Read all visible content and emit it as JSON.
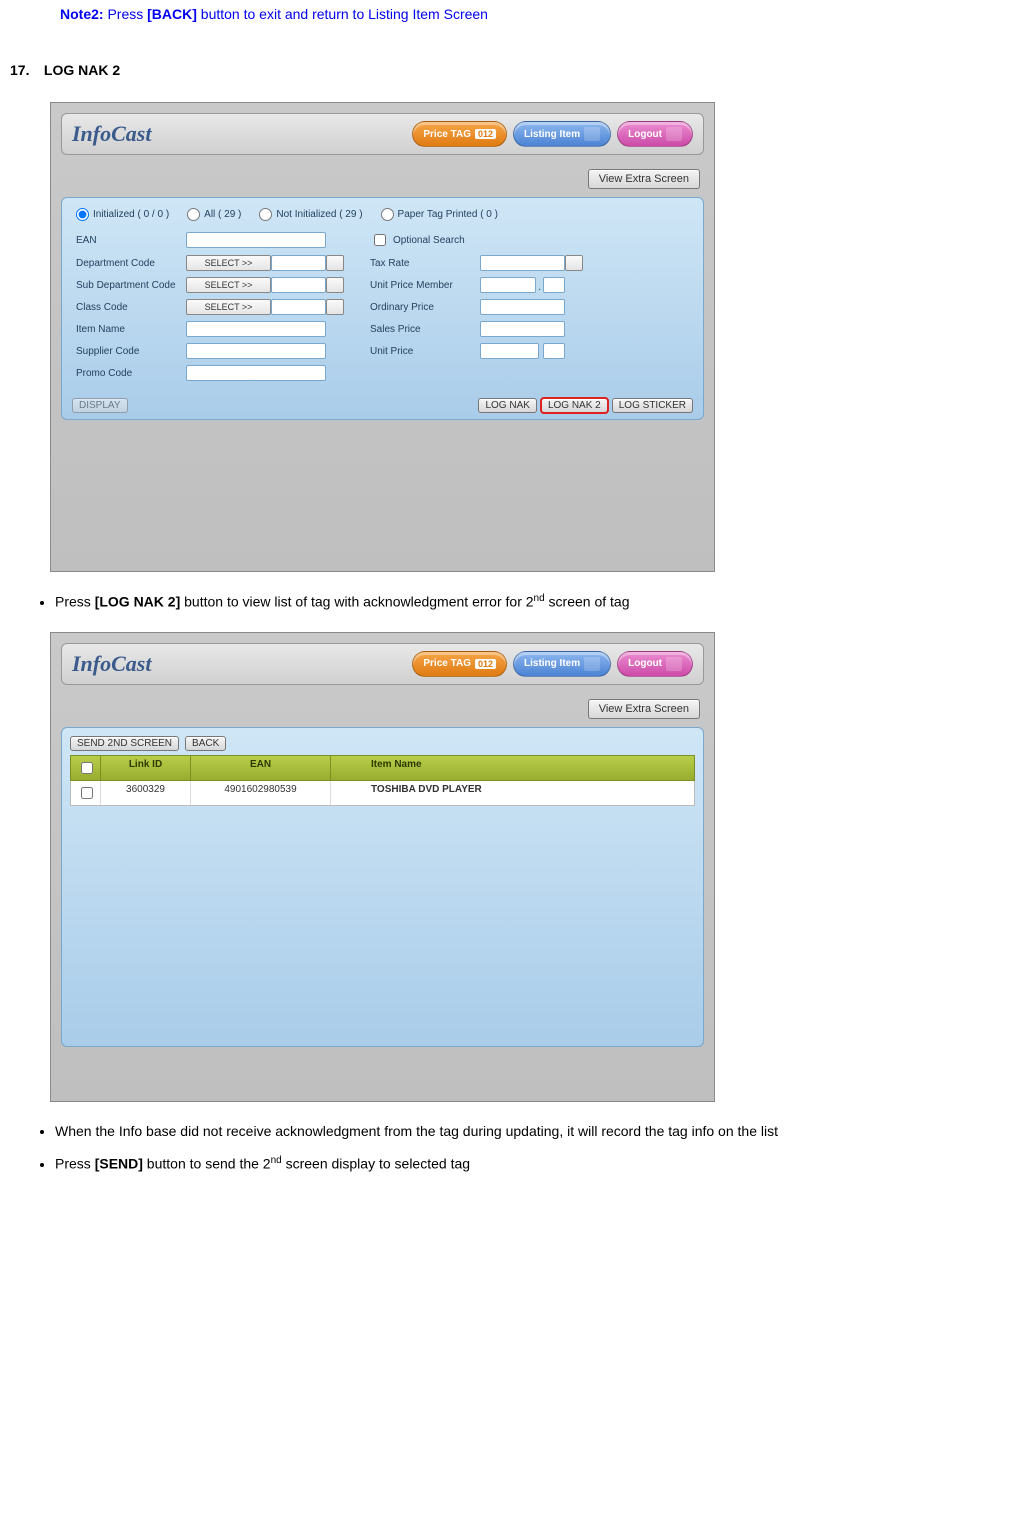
{
  "note": {
    "label": "Note2:",
    "text_before": " Press ",
    "back": "[BACK]",
    "text_after": " button to exit and return to Listing Item Screen"
  },
  "section": {
    "num": "17.",
    "title": "LOG NAK 2"
  },
  "logo": "InfoCast",
  "topButtons": {
    "priceTag": "Price TAG",
    "priceTagCode": "012",
    "listing": "Listing Item",
    "logout": "Logout"
  },
  "viewExtra": "View Extra Screen",
  "radios": {
    "r1": "Initialized ( 0 / 0 )",
    "r2": "All  ( 29 )",
    "r3": "Not Initialized  ( 29 )",
    "r4": "Paper Tag Printed  ( 0 )"
  },
  "formLabels": {
    "ean": "EAN",
    "opt": "Optional Search",
    "dept": "Department Code",
    "select": "SELECT >>",
    "tax": "Tax Rate",
    "subdept": "Sub Department Code",
    "upm": "Unit Price Member",
    "class": "Class Code",
    "ord": "Ordinary Price",
    "item": "Item Name",
    "sales": "Sales Price",
    "supp": "Supplier Code",
    "unit": "Unit Price",
    "promo": "Promo Code"
  },
  "bottomBtns": {
    "display": "DISPLAY",
    "lognak": "LOG NAK",
    "lognak2": "LOG NAK 2",
    "logsticker": "LOG STICKER"
  },
  "bullets": {
    "b1_pre": "Press ",
    "b1_btn": "[LOG NAK 2]",
    "b1_post_a": " button to view list of tag with acknowledgment error for 2",
    "b1_sup": "nd",
    "b1_post_b": " screen of tag",
    "b2": "When the Info base did not receive acknowledgment from the tag during updating, it will record the tag info on the list",
    "b3_pre": "Press ",
    "b3_btn": "[SEND]",
    "b3_post_a": " button to send the 2",
    "b3_sup": "nd",
    "b3_post_b": " screen display to selected tag"
  },
  "panel2Btns": {
    "send": "SEND 2ND SCREEN",
    "back": "BACK"
  },
  "tableHead": {
    "linkid": "Link ID",
    "ean": "EAN",
    "itemname": "Item Name"
  },
  "tableRow": {
    "linkid": "3600329",
    "ean": "4901602980539",
    "itemname": "TOSHIBA DVD PLAYER"
  }
}
